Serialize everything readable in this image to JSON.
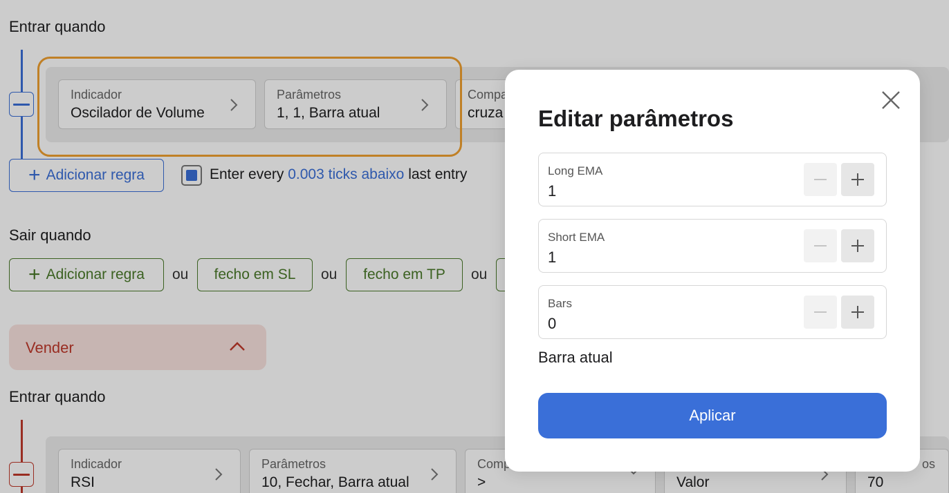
{
  "buy_section": {
    "enter_title": "Entrar quando",
    "rule": {
      "indicator": {
        "label": "Indicador",
        "value": "Oscilador de Volume"
      },
      "params": {
        "label": "Parâmetros",
        "value": "1, 1, Barra atual"
      },
      "comparator": {
        "label": "Compa",
        "value": "cruza"
      }
    },
    "add_rule": "Adicionar regra",
    "entry_prefix": "Enter every",
    "entry_link": "0.003 ticks abaixo",
    "entry_suffix": "last entry",
    "exit_title": "Sair quando",
    "exit_add_rule": "Adicionar regra",
    "or_label": "ou",
    "exit_sl": "fecho em SL",
    "exit_tp": "fecho em TP"
  },
  "sell_section": {
    "header": "Vender",
    "enter_title": "Entrar quando",
    "rule": {
      "indicator": {
        "label": "Indicador",
        "value": "RSI"
      },
      "params": {
        "label": "Parâmetros",
        "value": "10, Fechar, Barra atual"
      },
      "comparator": {
        "label": "Comp",
        "value": ">"
      },
      "target": {
        "label": "",
        "value": "Valor"
      },
      "value": {
        "label": "os",
        "value": "70"
      }
    }
  },
  "modal": {
    "title": "Editar parâmetros",
    "params": [
      {
        "label": "Long EMA",
        "value": "1"
      },
      {
        "label": "Short EMA",
        "value": "1"
      },
      {
        "label": "Bars",
        "value": "0"
      }
    ],
    "bar_label": "Barra atual",
    "apply_label": "Aplicar"
  },
  "colors": {
    "accent_blue": "#3a6fd8",
    "buy_line": "#3a6fd8",
    "sell_line": "#c0392b",
    "exit_green": "#4a7a2a",
    "highlight_orange": "#f0a030"
  },
  "icons": {
    "chevron": "chevron-right-icon",
    "close": "close-icon",
    "plus": "plus-icon",
    "minus": "minus-icon",
    "chevron_up": "chevron-up-icon"
  }
}
